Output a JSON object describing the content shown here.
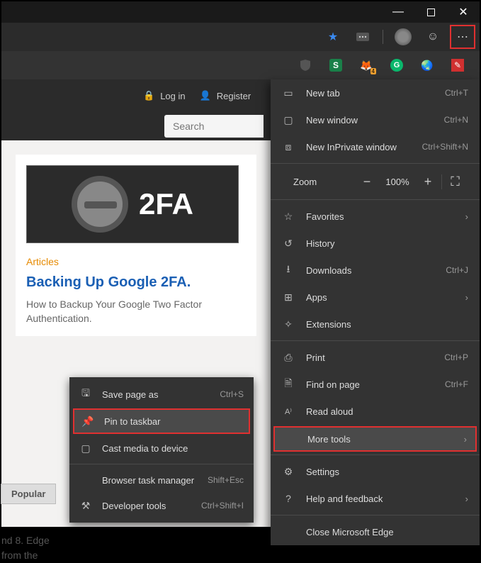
{
  "window": {
    "min": "—",
    "max": "▢",
    "close": "✕"
  },
  "toolbar": {
    "star": "★",
    "smile": "☺",
    "more": "⋯"
  },
  "ext": {
    "ublock": "uD",
    "s": "S",
    "fox": "🦊",
    "g": "G",
    "au": "🇦🇺",
    "pen": "✎"
  },
  "header": {
    "login": "Log in",
    "register": "Register"
  },
  "search": {
    "placeholder": "Search"
  },
  "article": {
    "banner_text": "2FA",
    "category": "Articles",
    "title": "Backing Up Google 2FA.",
    "desc": "How to Backup Your Google Two Factor Authentication."
  },
  "sidebar": {
    "popular": "Popular",
    "text1": "nd 8. Edge",
    "text2": "from the"
  },
  "menu": {
    "newtab": {
      "label": "New tab",
      "short": "Ctrl+T"
    },
    "newwin": {
      "label": "New window",
      "short": "Ctrl+N"
    },
    "inprivate": {
      "label": "New InPrivate window",
      "short": "Ctrl+Shift+N"
    },
    "zoom_label": "Zoom",
    "zoom_minus": "−",
    "zoom_val": "100%",
    "zoom_plus": "+",
    "zoom_full": "⛶",
    "fav": {
      "label": "Favorites"
    },
    "hist": {
      "label": "History"
    },
    "down": {
      "label": "Downloads",
      "short": "Ctrl+J"
    },
    "apps": {
      "label": "Apps"
    },
    "ext_lbl": {
      "label": "Extensions"
    },
    "print": {
      "label": "Print",
      "short": "Ctrl+P"
    },
    "find": {
      "label": "Find on page",
      "short": "Ctrl+F"
    },
    "read": {
      "label": "Read aloud"
    },
    "more": {
      "label": "More tools"
    },
    "settings": {
      "label": "Settings"
    },
    "help": {
      "label": "Help and feedback"
    },
    "close": {
      "label": "Close Microsoft Edge"
    }
  },
  "submenu": {
    "save": {
      "label": "Save page as",
      "short": "Ctrl+S"
    },
    "pin": {
      "label": "Pin to taskbar"
    },
    "cast": {
      "label": "Cast media to device"
    },
    "task": {
      "label": "Browser task manager",
      "short": "Shift+Esc"
    },
    "dev": {
      "label": "Developer tools",
      "short": "Ctrl+Shift+I"
    }
  }
}
